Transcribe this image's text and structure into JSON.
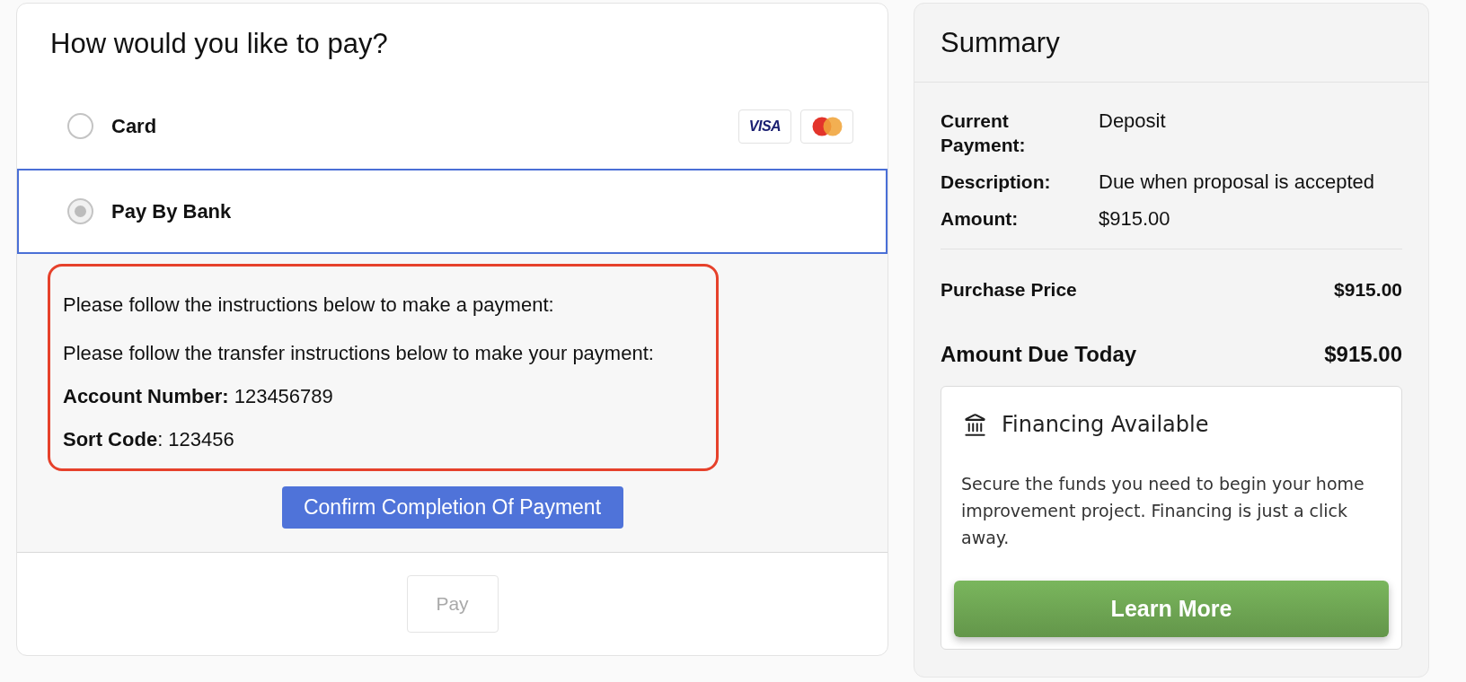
{
  "payment": {
    "title": "How would you like to pay?",
    "options": [
      {
        "label": "Card",
        "selected": false,
        "logos": [
          {
            "kind": "wordmark",
            "text": "VISA"
          },
          {
            "kind": "circles"
          }
        ]
      },
      {
        "label": "Pay By Bank",
        "selected": true
      }
    ],
    "instructions": [
      "Please follow the instructions below to make a payment:",
      "Please follow the transfer instructions below to make your payment:",
      "**Account Number:** 123456789",
      "**Sort Code**: 123456"
    ],
    "confirm_button": "Confirm Completion Of Payment",
    "pay_button": {
      "label": "Pay",
      "disabled": true
    }
  },
  "summary": {
    "title": "Summary",
    "details": [
      {
        "label": "Current Payment:",
        "value": "Deposit"
      },
      {
        "label": "Description:",
        "value": "Due when proposal is accepted"
      },
      {
        "label": "Amount:",
        "value": "$915.00"
      }
    ],
    "totals": [
      {
        "kind": "subtotal",
        "label": "Purchase Price",
        "value": "$915.00"
      },
      {
        "kind": "due",
        "label": "Amount Due Today",
        "value": "$915.00"
      }
    ],
    "financing": {
      "title": "Financing Available",
      "text": "Secure the funds you need to begin your home improvement project. Financing is just a click away.",
      "button": "Learn More"
    }
  }
}
